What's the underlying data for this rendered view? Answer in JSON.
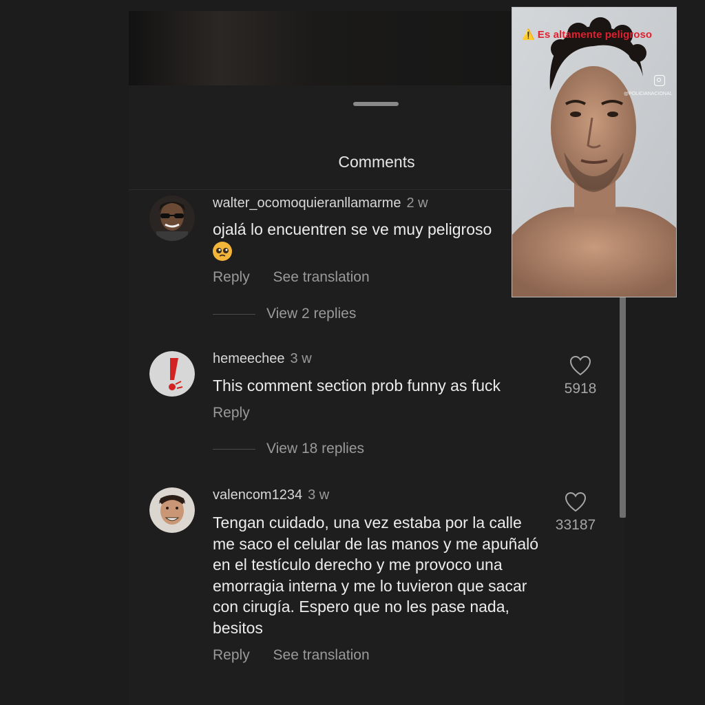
{
  "sheet": {
    "title": "Comments"
  },
  "comments": [
    {
      "username": "walter_ocomoquieranllamarme",
      "time": "2 w",
      "text": "ojalá lo encuentren se ve muy peligroso",
      "emoji": "🥺",
      "reply_label": "Reply",
      "translate_label": "See translation",
      "view_replies": "View 2 replies",
      "avatar_icon": "avatar-sunglasses-man"
    },
    {
      "username": "hemeechee",
      "time": "3 w",
      "text": "This comment section prob funny as fuck",
      "reply_label": "Reply",
      "likes": "5918",
      "view_replies": "View 18 replies",
      "avatar_icon": "avatar-red-exclamation"
    },
    {
      "username": "valencom1234",
      "time": "3 w",
      "text": "Tengan cuidado, una vez estaba por la calle me saco el celular de las manos y me apuñaló en el testículo derecho y me provoco una emorragia interna y me lo tuvieron que sacar con cirugía. Espero que no les pase nada, besitos",
      "reply_label": "Reply",
      "translate_label": "See translation",
      "likes": "33187",
      "avatar_icon": "avatar-smiling-man"
    }
  ],
  "inset": {
    "caption_icon": "⚠️",
    "caption": "Es altamente peligroso",
    "handle": "@POLICIANACIONAL",
    "caption_color": "#e0202e"
  },
  "colors": {
    "background": "#1c1c1d",
    "sheet": "#1e1e1f",
    "muted_text": "#9a9a9a"
  }
}
